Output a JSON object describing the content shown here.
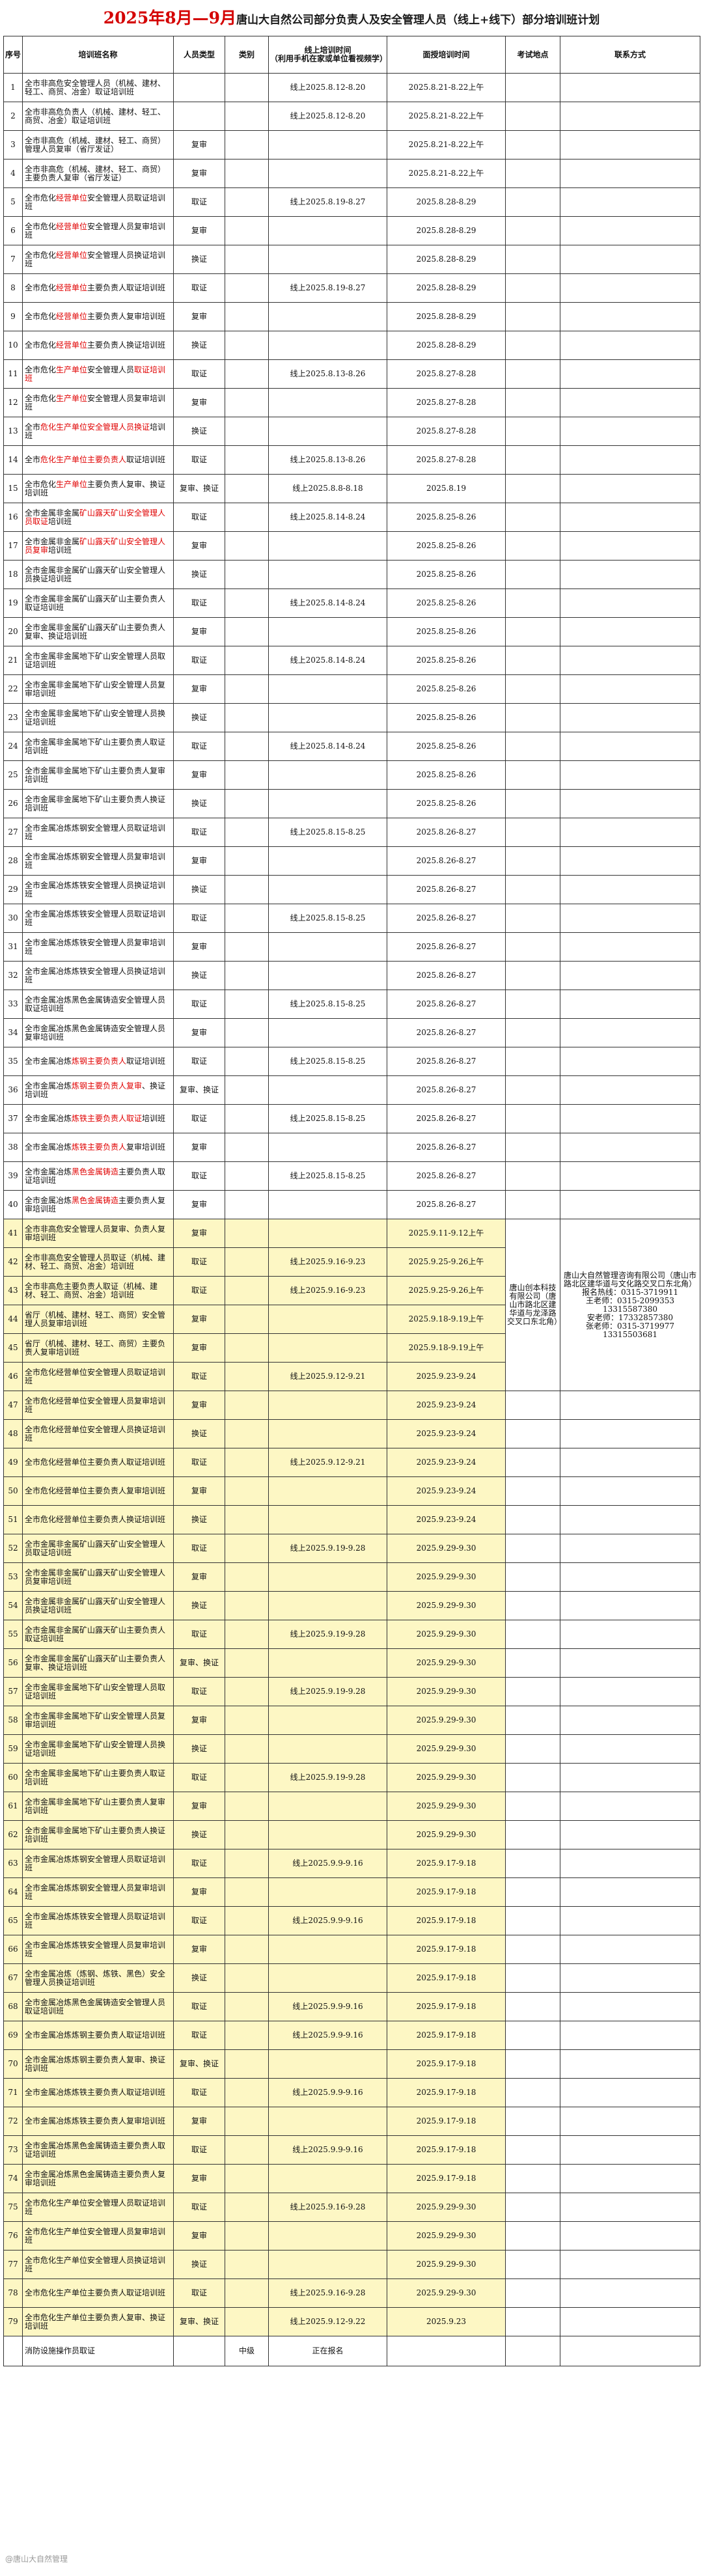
{
  "title": {
    "red": "2025年8月—9月",
    "black": "唐山大自然公司部分负责人及安全管理人员（线上+线下）部分培训班计划"
  },
  "headers": {
    "no": "序号",
    "name": "培训班名称",
    "type": "人员类型",
    "cat": "类别",
    "online_l1": "线上培训时间",
    "online_l2": "（利用手机在家或单位看视频学）",
    "offline": "面授培训时间",
    "exam": "考试地点",
    "contact": "联系方式"
  },
  "rows": [
    {
      "no": "1",
      "name": [
        [
          "全市非高危安全管理人员（机械、建材、轻工、商贸、冶金）取证培训班",
          ""
        ]
      ],
      "type": "",
      "online": "线上2025.8.12-8.20",
      "offline": "2025.8.21-8.22上午"
    },
    {
      "no": "2",
      "name": [
        [
          "全市非高危负责人（机械、建材、轻工、商贸、冶金）取证培训班",
          ""
        ]
      ],
      "type": "",
      "online": "线上2025.8.12-8.20",
      "offline": "2025.8.21-8.22上午"
    },
    {
      "no": "3",
      "name": [
        [
          "全市非高危（机械、建材、轻工、商贸）管理人员复审（省厅发证）",
          ""
        ]
      ],
      "type": "复审",
      "online": "",
      "offline": "2025.8.21-8.22上午"
    },
    {
      "no": "4",
      "name": [
        [
          "全市非高危（机械、建材、轻工、商贸）主要负责人复审（省厅发证）",
          ""
        ]
      ],
      "type": "复审",
      "online": "",
      "offline": "2025.8.21-8.22上午"
    },
    {
      "no": "5",
      "name": [
        [
          "全市危化",
          ""
        ],
        [
          "经营单位",
          "r"
        ],
        [
          "安全管理人员取证培训班",
          ""
        ]
      ],
      "type": "取证",
      "online": "线上2025.8.19-8.27",
      "offline": "2025.8.28-8.29"
    },
    {
      "no": "6",
      "name": [
        [
          "全市危化",
          ""
        ],
        [
          "经营单位",
          "r"
        ],
        [
          "安全管理人员复审培训班",
          ""
        ]
      ],
      "type": "复审",
      "online": "",
      "offline": "2025.8.28-8.29"
    },
    {
      "no": "7",
      "name": [
        [
          "全市危化",
          ""
        ],
        [
          "经营单位",
          "r"
        ],
        [
          "安全管理人员换证培训班",
          ""
        ]
      ],
      "type": "换证",
      "online": "",
      "offline": "2025.8.28-8.29"
    },
    {
      "no": "8",
      "name": [
        [
          "全市危化",
          ""
        ],
        [
          "经营单位",
          "r"
        ],
        [
          "主要负责人取证培训班",
          ""
        ]
      ],
      "type": "取证",
      "online": "线上2025.8.19-8.27",
      "offline": "2025.8.28-8.29"
    },
    {
      "no": "9",
      "name": [
        [
          "全市危化",
          ""
        ],
        [
          "经营单位",
          "r"
        ],
        [
          "主要负责人复审培训班",
          ""
        ]
      ],
      "type": "复审",
      "online": "",
      "offline": "2025.8.28-8.29"
    },
    {
      "no": "10",
      "name": [
        [
          "全市危化",
          ""
        ],
        [
          "经营单位",
          "r"
        ],
        [
          "主要负责人换证培训班",
          ""
        ]
      ],
      "type": "换证",
      "online": "",
      "offline": "2025.8.28-8.29"
    },
    {
      "no": "11",
      "name": [
        [
          "全市危化",
          ""
        ],
        [
          "生产单位",
          "r"
        ],
        [
          "安全管理人员",
          ""
        ],
        [
          "取证培训班",
          "r"
        ]
      ],
      "type": "取证",
      "online": "线上2025.8.13-8.26",
      "offline": "2025.8.27-8.28"
    },
    {
      "no": "12",
      "name": [
        [
          "全市危化",
          ""
        ],
        [
          "生产单位",
          "r"
        ],
        [
          "安全管理人员复审培训班",
          ""
        ]
      ],
      "type": "复审",
      "online": "",
      "offline": "2025.8.27-8.28"
    },
    {
      "no": "13",
      "name": [
        [
          "全市",
          ""
        ],
        [
          "危化生产单位安全管理人员换证",
          "r"
        ],
        [
          "培训班",
          ""
        ]
      ],
      "type": "换证",
      "online": "",
      "offline": "2025.8.27-8.28"
    },
    {
      "no": "14",
      "name": [
        [
          "全市",
          ""
        ],
        [
          "危化生产单位主要负责人",
          "r"
        ],
        [
          "取证培训班",
          ""
        ]
      ],
      "type": "取证",
      "online": "线上2025.8.13-8.26",
      "offline": "2025.8.27-8.28"
    },
    {
      "no": "15",
      "name": [
        [
          "全市危化",
          ""
        ],
        [
          "生产单位",
          "r"
        ],
        [
          "主要负责人复审、换证培训班",
          ""
        ]
      ],
      "type": "复审、换证",
      "online": "线上2025.8.8-8.18",
      "offline": "2025.8.19"
    },
    {
      "no": "16",
      "name": [
        [
          "全市金属非金属",
          ""
        ],
        [
          "矿山露天矿山安全管理人员取证",
          "r"
        ],
        [
          "培训班",
          ""
        ]
      ],
      "type": "取证",
      "online": "线上2025.8.14-8.24",
      "offline": "2025.8.25-8.26"
    },
    {
      "no": "17",
      "name": [
        [
          "全市金属非金属",
          ""
        ],
        [
          "矿山露天矿山安全管理人员复审",
          "r"
        ],
        [
          "培训班",
          ""
        ]
      ],
      "type": "复审",
      "online": "",
      "offline": "2025.8.25-8.26"
    },
    {
      "no": "18",
      "name": [
        [
          "全市金属非金属矿山露天矿山安全管理人员换证培训班",
          ""
        ]
      ],
      "type": "换证",
      "online": "",
      "offline": "2025.8.25-8.26"
    },
    {
      "no": "19",
      "name": [
        [
          "全市金属非金属矿山露天矿山主要负责人取证培训班",
          ""
        ]
      ],
      "type": "取证",
      "online": "线上2025.8.14-8.24",
      "offline": "2025.8.25-8.26"
    },
    {
      "no": "20",
      "name": [
        [
          "全市金属非金属矿山露天矿山主要负责人复审、换证培训班",
          ""
        ]
      ],
      "type": "复审",
      "online": "",
      "offline": "2025.8.25-8.26"
    },
    {
      "no": "21",
      "name": [
        [
          "全市金属非金属地下矿山安全管理人员取证培训班",
          ""
        ]
      ],
      "type": "取证",
      "online": "线上2025.8.14-8.24",
      "offline": "2025.8.25-8.26"
    },
    {
      "no": "22",
      "name": [
        [
          "全市金属非金属地下矿山安全管理人员复审培训班",
          ""
        ]
      ],
      "type": "复审",
      "online": "",
      "offline": "2025.8.25-8.26"
    },
    {
      "no": "23",
      "name": [
        [
          "全市金属非金属地下矿山安全管理人员换证培训班",
          ""
        ]
      ],
      "type": "换证",
      "online": "",
      "offline": "2025.8.25-8.26"
    },
    {
      "no": "24",
      "name": [
        [
          "全市金属非金属地下矿山主要负责人取证培训班",
          ""
        ]
      ],
      "type": "取证",
      "online": "线上2025.8.14-8.24",
      "offline": "2025.8.25-8.26"
    },
    {
      "no": "25",
      "name": [
        [
          "全市金属非金属地下矿山主要负责人复审培训班",
          ""
        ]
      ],
      "type": "复审",
      "online": "",
      "offline": "2025.8.25-8.26"
    },
    {
      "no": "26",
      "name": [
        [
          "全市金属非金属地下矿山主要负责人换证培训班",
          ""
        ]
      ],
      "type": "换证",
      "online": "",
      "offline": "2025.8.25-8.26"
    },
    {
      "no": "27",
      "name": [
        [
          "全市金属冶炼炼钢安全管理人员取证培训班",
          ""
        ]
      ],
      "type": "取证",
      "online": "线上2025.8.15-8.25",
      "offline": "2025.8.26-8.27"
    },
    {
      "no": "28",
      "name": [
        [
          "全市金属冶炼炼钢安全管理人员复审培训班",
          ""
        ]
      ],
      "type": "复审",
      "online": "",
      "offline": "2025.8.26-8.27"
    },
    {
      "no": "29",
      "name": [
        [
          "全市金属冶炼炼铁安全管理人员换证培训班",
          ""
        ]
      ],
      "type": "换证",
      "online": "",
      "offline": "2025.8.26-8.27"
    },
    {
      "no": "30",
      "name": [
        [
          "全市金属冶炼炼铁安全管理人员取证培训班",
          ""
        ]
      ],
      "type": "取证",
      "online": "线上2025.8.15-8.25",
      "offline": "2025.8.26-8.27"
    },
    {
      "no": "31",
      "name": [
        [
          "全市金属冶炼炼铁安全管理人员复审培训班",
          ""
        ]
      ],
      "type": "复审",
      "online": "",
      "offline": "2025.8.26-8.27"
    },
    {
      "no": "32",
      "name": [
        [
          "全市金属冶炼炼铁安全管理人员换证培训班",
          ""
        ]
      ],
      "type": "换证",
      "online": "",
      "offline": "2025.8.26-8.27"
    },
    {
      "no": "33",
      "name": [
        [
          "全市金属冶炼黑色金属铸造安全管理人员取证培训班",
          ""
        ]
      ],
      "type": "取证",
      "online": "线上2025.8.15-8.25",
      "offline": "2025.8.26-8.27"
    },
    {
      "no": "34",
      "name": [
        [
          "全市金属冶炼黑色金属铸造安全管理人员复审培训班",
          ""
        ]
      ],
      "type": "复审",
      "online": "",
      "offline": "2025.8.26-8.27"
    },
    {
      "no": "35",
      "name": [
        [
          "全市金属冶炼",
          ""
        ],
        [
          "炼钢主要负责人",
          "r"
        ],
        [
          "取证培训班",
          ""
        ]
      ],
      "type": "取证",
      "online": "线上2025.8.15-8.25",
      "offline": "2025.8.26-8.27"
    },
    {
      "no": "36",
      "name": [
        [
          "全市金属冶炼",
          ""
        ],
        [
          "炼钢主要负责人复审",
          "r"
        ],
        [
          "、换证培训班",
          ""
        ]
      ],
      "type": "复审、换证",
      "online": "",
      "offline": "2025.8.26-8.27"
    },
    {
      "no": "37",
      "name": [
        [
          "全市金属冶炼",
          ""
        ],
        [
          "炼铁主要负责人取证",
          "r"
        ],
        [
          "培训班",
          ""
        ]
      ],
      "type": "取证",
      "online": "线上2025.8.15-8.25",
      "offline": "2025.8.26-8.27"
    },
    {
      "no": "38",
      "name": [
        [
          "全市金属冶炼",
          ""
        ],
        [
          "炼铁主要负责人",
          "r"
        ],
        [
          "复审培训班",
          ""
        ]
      ],
      "type": "复审",
      "online": "",
      "offline": "2025.8.26-8.27"
    },
    {
      "no": "39",
      "name": [
        [
          "全市金属冶炼",
          ""
        ],
        [
          "黑色金属铸造",
          "r"
        ],
        [
          "主要负责人取证培训班",
          ""
        ]
      ],
      "type": "取证",
      "online": "线上2025.8.15-8.25",
      "offline": "2025.8.26-8.27"
    },
    {
      "no": "40",
      "name": [
        [
          "全市金属冶炼",
          ""
        ],
        [
          "黑色金属铸造",
          "r"
        ],
        [
          "主要负责人复审培训班",
          ""
        ]
      ],
      "type": "复审",
      "online": "",
      "offline": "2025.8.26-8.27"
    },
    {
      "no": "41",
      "name": [
        [
          "全市非高危安全管理人员复审、负责人复审培训班",
          ""
        ]
      ],
      "type": "复审",
      "online": "",
      "offline": "2025.9.11-9.12上午"
    },
    {
      "no": "42",
      "name": [
        [
          "全市非高危安全管理人员取证（机械、建材、轻工、商贸、冶金）培训班",
          ""
        ]
      ],
      "type": "取证",
      "online": "线上2025.9.16-9.23",
      "offline": "2025.9.25-9.26上午"
    },
    {
      "no": "43",
      "name": [
        [
          "全市非高危主要负责人取证（机械、建材、轻工、商贸、冶金）培训班",
          ""
        ]
      ],
      "type": "取证",
      "online": "线上2025.9.16-9.23",
      "offline": "2025.9.25-9.26上午"
    },
    {
      "no": "44",
      "name": [
        [
          "省厅（机械、建材、轻工、商贸）安全管理人员复审培训班",
          ""
        ]
      ],
      "type": "复审",
      "online": "",
      "offline": "2025.9.18-9.19上午"
    },
    {
      "no": "45",
      "name": [
        [
          "省厅（机械、建材、轻工、商贸）主要负责人复审培训班",
          ""
        ]
      ],
      "type": "复审",
      "online": "",
      "offline": "2025.9.18-9.19上午"
    },
    {
      "no": "46",
      "name": [
        [
          "全市危化经营单位安全管理人员取证培训班",
          ""
        ]
      ],
      "type": "取证",
      "online": "线上2025.9.12-9.21",
      "offline": "2025.9.23-9.24"
    },
    {
      "no": "47",
      "name": [
        [
          "全市危化经营单位安全管理人员复审培训班",
          ""
        ]
      ],
      "type": "复审",
      "online": "",
      "offline": "2025.9.23-9.24"
    },
    {
      "no": "48",
      "name": [
        [
          "全市危化经营单位安全管理人员换证培训班",
          ""
        ]
      ],
      "type": "换证",
      "online": "",
      "offline": "2025.9.23-9.24"
    },
    {
      "no": "49",
      "name": [
        [
          "全市危化经营单位主要负责人取证培训班",
          ""
        ]
      ],
      "type": "取证",
      "online": "线上2025.9.12-9.21",
      "offline": "2025.9.23-9.24"
    },
    {
      "no": "50",
      "name": [
        [
          "全市危化经营单位主要负责人复审培训班",
          ""
        ]
      ],
      "type": "复审",
      "online": "",
      "offline": "2025.9.23-9.24"
    },
    {
      "no": "51",
      "name": [
        [
          "全市危化经营单位主要负责人换证培训班",
          ""
        ]
      ],
      "type": "换证",
      "online": "",
      "offline": "2025.9.23-9.24"
    },
    {
      "no": "52",
      "name": [
        [
          "全市金属非金属矿山露天矿山安全管理人员取证培训班",
          ""
        ]
      ],
      "type": "取证",
      "online": "线上2025.9.19-9.28",
      "offline": "2025.9.29-9.30"
    },
    {
      "no": "53",
      "name": [
        [
          "全市金属非金属矿山露天矿山安全管理人员复审培训班",
          ""
        ]
      ],
      "type": "复审",
      "online": "",
      "offline": "2025.9.29-9.30"
    },
    {
      "no": "54",
      "name": [
        [
          "全市金属非金属矿山露天矿山安全管理人员换证培训班",
          ""
        ]
      ],
      "type": "换证",
      "online": "",
      "offline": "2025.9.29-9.30"
    },
    {
      "no": "55",
      "name": [
        [
          "全市金属非金属矿山露天矿山主要负责人取证培训班",
          ""
        ]
      ],
      "type": "取证",
      "online": "线上2025.9.19-9.28",
      "offline": "2025.9.29-9.30"
    },
    {
      "no": "56",
      "name": [
        [
          "全市金属非金属矿山露天矿山主要负责人复审、换证培训班",
          ""
        ]
      ],
      "type": "复审、换证",
      "online": "",
      "offline": "2025.9.29-9.30"
    },
    {
      "no": "57",
      "name": [
        [
          "全市金属非金属地下矿山安全管理人员取证培训班",
          ""
        ]
      ],
      "type": "取证",
      "online": "线上2025.9.19-9.28",
      "offline": "2025.9.29-9.30"
    },
    {
      "no": "58",
      "name": [
        [
          "全市金属非金属地下矿山安全管理人员复审培训班",
          ""
        ]
      ],
      "type": "复审",
      "online": "",
      "offline": "2025.9.29-9.30"
    },
    {
      "no": "59",
      "name": [
        [
          "全市金属非金属地下矿山安全管理人员换证培训班",
          ""
        ]
      ],
      "type": "换证",
      "online": "",
      "offline": "2025.9.29-9.30"
    },
    {
      "no": "60",
      "name": [
        [
          "全市金属非金属地下矿山主要负责人取证培训班",
          ""
        ]
      ],
      "type": "取证",
      "online": "线上2025.9.19-9.28",
      "offline": "2025.9.29-9.30"
    },
    {
      "no": "61",
      "name": [
        [
          "全市金属非金属地下矿山主要负责人复审培训班",
          ""
        ]
      ],
      "type": "复审",
      "online": "",
      "offline": "2025.9.29-9.30"
    },
    {
      "no": "62",
      "name": [
        [
          "全市金属非金属地下矿山主要负责人换证培训班",
          ""
        ]
      ],
      "type": "换证",
      "online": "",
      "offline": "2025.9.29-9.30"
    },
    {
      "no": "63",
      "name": [
        [
          "全市金属冶炼炼钢安全管理人员取证培训班",
          ""
        ]
      ],
      "type": "取证",
      "online": "线上2025.9.9-9.16",
      "offline": "2025.9.17-9.18"
    },
    {
      "no": "64",
      "name": [
        [
          "全市金属冶炼炼钢安全管理人员复审培训班",
          ""
        ]
      ],
      "type": "复审",
      "online": "",
      "offline": "2025.9.17-9.18"
    },
    {
      "no": "65",
      "name": [
        [
          "全市金属冶炼炼铁安全管理人员取证培训班",
          ""
        ]
      ],
      "type": "取证",
      "online": "线上2025.9.9-9.16",
      "offline": "2025.9.17-9.18"
    },
    {
      "no": "66",
      "name": [
        [
          "全市金属冶炼炼铁安全管理人员复审培训班",
          ""
        ]
      ],
      "type": "复审",
      "online": "",
      "offline": "2025.9.17-9.18"
    },
    {
      "no": "67",
      "name": [
        [
          "全市金属冶炼（炼钢、炼铁、黑色）安全管理人员换证培训班",
          ""
        ]
      ],
      "type": "换证",
      "online": "",
      "offline": "2025.9.17-9.18"
    },
    {
      "no": "68",
      "name": [
        [
          "全市金属冶炼黑色金属铸造安全管理人员取证培训班",
          ""
        ]
      ],
      "type": "取证",
      "online": "线上2025.9.9-9.16",
      "offline": "2025.9.17-9.18"
    },
    {
      "no": "69",
      "name": [
        [
          "全市金属冶炼炼钢主要负责人取证培训班",
          ""
        ]
      ],
      "type": "取证",
      "online": "线上2025.9.9-9.16",
      "offline": "2025.9.17-9.18"
    },
    {
      "no": "70",
      "name": [
        [
          "全市金属冶炼炼钢主要负责人复审、换证培训班",
          ""
        ]
      ],
      "type": "复审、换证",
      "online": "",
      "offline": "2025.9.17-9.18"
    },
    {
      "no": "71",
      "name": [
        [
          "全市金属冶炼炼铁主要负责人取证培训班",
          ""
        ]
      ],
      "type": "取证",
      "online": "线上2025.9.9-9.16",
      "offline": "2025.9.17-9.18"
    },
    {
      "no": "72",
      "name": [
        [
          "全市金属冶炼炼铁主要负责人复审培训班",
          ""
        ]
      ],
      "type": "复审",
      "online": "",
      "offline": "2025.9.17-9.18"
    },
    {
      "no": "73",
      "name": [
        [
          "全市金属冶炼黑色金属铸造主要负责人取证培训班",
          ""
        ]
      ],
      "type": "取证",
      "online": "线上2025.9.9-9.16",
      "offline": "2025.9.17-9.18"
    },
    {
      "no": "74",
      "name": [
        [
          "全市金属冶炼黑色金属铸造主要负责人复审培训班",
          ""
        ]
      ],
      "type": "复审",
      "online": "",
      "offline": "2025.9.17-9.18"
    },
    {
      "no": "75",
      "name": [
        [
          "全市危化生产单位安全管理人员取证培训班",
          ""
        ]
      ],
      "type": "取证",
      "online": "线上2025.9.16-9.28",
      "offline": "2025.9.29-9.30"
    },
    {
      "no": "76",
      "name": [
        [
          "全市危化生产单位安全管理人员复审培训班",
          ""
        ]
      ],
      "type": "复审",
      "online": "",
      "offline": "2025.9.29-9.30"
    },
    {
      "no": "77",
      "name": [
        [
          "全市危化生产单位安全管理人员换证培训班",
          ""
        ]
      ],
      "type": "换证",
      "online": "",
      "offline": "2025.9.29-9.30"
    },
    {
      "no": "78",
      "name": [
        [
          "全市危化生产单位主要负责人取证培训班",
          ""
        ]
      ],
      "type": "取证",
      "online": "线上2025.9.16-9.28",
      "offline": "2025.9.29-9.30"
    },
    {
      "no": "79",
      "name": [
        [
          "全市危化生产单位主要负责人复审、换证培训班",
          ""
        ]
      ],
      "type": "复审、换证",
      "online": "线上2025.9.12-9.22",
      "offline": "2025.9.23"
    }
  ],
  "footer": {
    "name": "消防设施操作员取证",
    "type": "中级",
    "status": "正在报名"
  },
  "exam_location": "唐山创本科技有限公司（唐山市路北区建华道与龙泽路交叉口东北角）",
  "contact": [
    "唐山大自然管理咨询有限公司（唐山市路北区建华道与文化路交叉口东北角）",
    "报名热线：0315-3719911",
    "王老师：0315-2099353",
    "13315587380",
    "安老师：17332857380",
    "张老师：0315-3719977",
    "13315503681"
  ],
  "watermark": "@唐山大自然管理"
}
